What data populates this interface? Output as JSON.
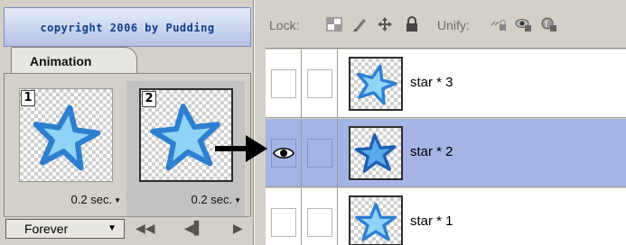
{
  "watermark": "copyright 2006 by Pudding",
  "animation_panel": {
    "tab_label": "Animation",
    "frames": [
      {
        "number": "1",
        "delay": "0.2 sec.",
        "selected": false
      },
      {
        "number": "2",
        "delay": "0.2 sec.",
        "selected": true
      }
    ],
    "loop_option": "Forever"
  },
  "layers_panel": {
    "lock_label": "Lock:",
    "unify_label": "Unify:",
    "layers": [
      {
        "name": "star * 3",
        "visible": false,
        "selected": false
      },
      {
        "name": "star * 2",
        "visible": true,
        "selected": true
      },
      {
        "name": "star * 1",
        "visible": false,
        "selected": false
      }
    ]
  },
  "colors": {
    "star_fill": "#8fd3f7",
    "star_outline": "#2e7fd0",
    "selected_row": "#a3b4e5",
    "panel_bg": "#d4d0c8"
  },
  "icons": {
    "lock_transparent": "checker-lock-icon",
    "lock_paint": "brush-icon",
    "lock_position": "move-icon",
    "lock_all": "padlock-icon",
    "unify_position": "unify-position-icon",
    "unify_visibility": "unify-visibility-icon",
    "unify_style": "unify-style-icon",
    "visibility": "eye-icon",
    "loop_dropdown": "chevron-down-icon",
    "first_frame": "first-frame-icon",
    "prev_frame": "previous-frame-icon",
    "play": "play-icon"
  }
}
